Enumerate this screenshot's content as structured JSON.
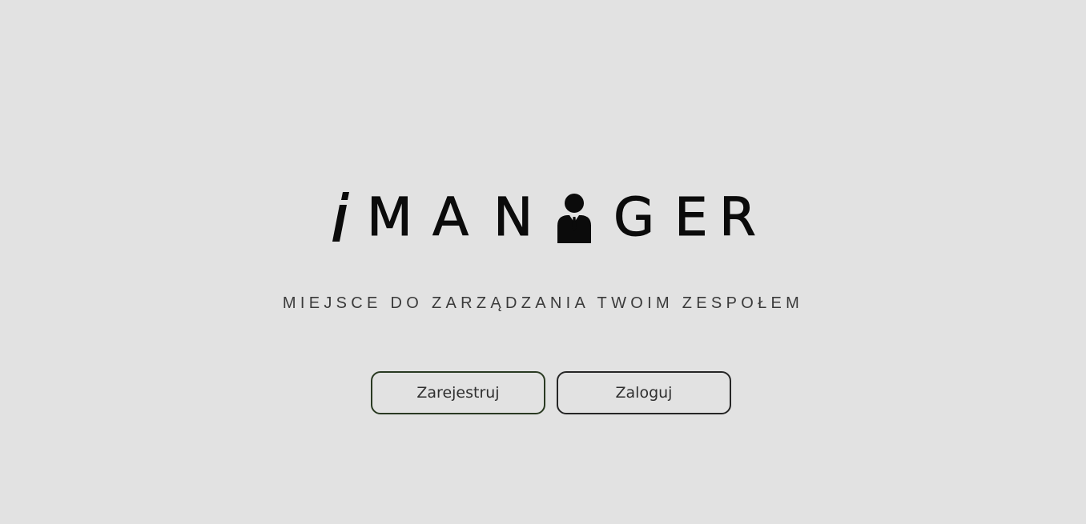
{
  "logo": {
    "letters_before": [
      "M",
      "A",
      "N"
    ],
    "letters_after": [
      "G",
      "E",
      "R"
    ],
    "icon": "businessman-icon"
  },
  "tagline": "MIEJSCE DO ZARZĄDZANIA TWOIM ZESPOŁEM",
  "buttons": {
    "register_label": "Zarejestruj",
    "login_label": "Zaloguj"
  },
  "colors": {
    "background": "#e2e2e2",
    "text": "#0b0b0b",
    "register_border": "#2a3a22",
    "login_border": "#262626"
  }
}
